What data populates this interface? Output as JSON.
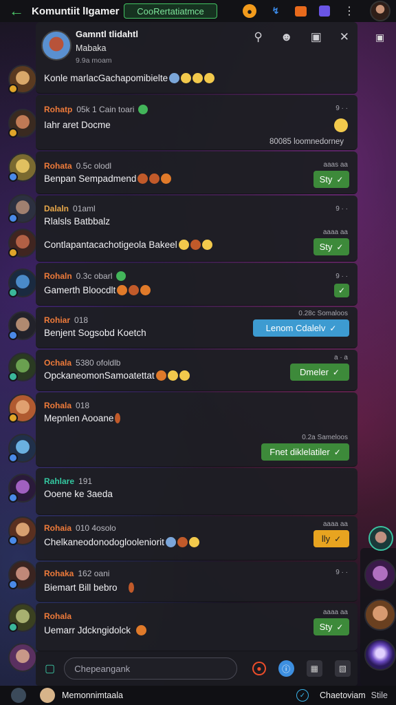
{
  "topbar": {
    "title": "Komuntiit lIgamer",
    "status": "CooRertatiatmce",
    "icons": [
      "back-arrow-icon",
      "coin-icon",
      "lightning-icon",
      "gift-icon",
      "square-icon",
      "more-dots-icon"
    ]
  },
  "header": {
    "name": "Gamntl tlidahtl",
    "sub": "Mabaka",
    "time": "9.9a moam",
    "pinned": "Konle marlacGachapomibielte"
  },
  "messages": [
    {
      "sender": "Rohatp",
      "meta": "05k 1 Cain toari",
      "text": "Iahr aret Docme",
      "timeline": "9 · ·",
      "footer": "80085 loomnedorney"
    },
    {
      "sender": "Rohata",
      "meta": "0.5c olodl",
      "text": "Benpan Sempadmend",
      "timeline": "aaas aa",
      "button": "Sty"
    },
    {
      "sender": "Dalaln",
      "meta": "01aml",
      "text": "Rlalsls Batbbalz",
      "timeline": "9 · ·",
      "text2": "Contlapantacachotigeola Bakeel",
      "timeline2": "aaaa aa",
      "button": "Sty"
    },
    {
      "sender": "Rohaln",
      "meta": "0.3c obarl",
      "text": "Gamerth Bloocdlt",
      "timeline": "9 · ·"
    },
    {
      "sender": "Rohiar",
      "meta": "018",
      "text": "Benjent Sogsobd Koetch",
      "timeline": "0.28c Somaloos",
      "button": "Lenom Cdalelv"
    },
    {
      "sender": "Ochala",
      "meta": "5380 ofoldlb",
      "text": "OpckaneomonSamoatettat",
      "timeline": "a · a",
      "button": "Dmeler"
    },
    {
      "sender": "Rohala",
      "meta": "018",
      "text": "Mepnlen Aooane",
      "timeline": "0.2a Sameloos",
      "button": "Fnet diklelatiler"
    },
    {
      "sender": "Rahlare",
      "meta": "191",
      "text": "Ooene ke 3aeda"
    },
    {
      "sender": "Rohaia",
      "meta": "010 4osolo",
      "text": "Chelkaneodonodoglooleniorit",
      "timeline": "aaaa aa",
      "button": "lly"
    },
    {
      "sender": "Rohaka",
      "meta": "162 oani",
      "text": "Biemart Bill bebro",
      "timeline": "9 · ·"
    },
    {
      "sender": "Rohala",
      "meta": "",
      "text": "Uemarr Jdckngidolck",
      "timeline": "aaaa aa",
      "button": "Sty"
    }
  ],
  "input": {
    "placeholder": "Chepeangank"
  },
  "bottombar": {
    "name": "Memonnimtaala",
    "right": "Chaetoviam",
    "right2": "Stile"
  },
  "colors": {
    "accent_green": "#3d8a3a",
    "accent_blue": "#3d9bd1",
    "accent_yellow": "#e8a420",
    "sender_orange": "#ef7b3a"
  }
}
